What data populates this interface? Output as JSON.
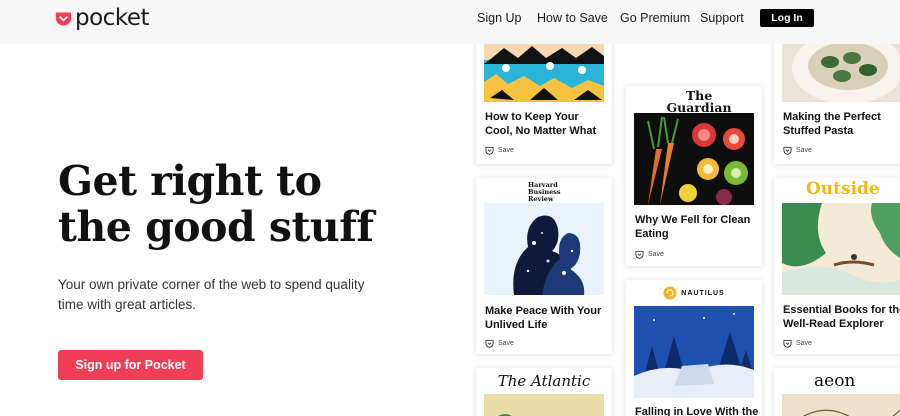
{
  "brand": {
    "name": "pocket",
    "color": "#ef3e56"
  },
  "nav": {
    "items": [
      "Sign Up",
      "How to Save",
      "Go Premium",
      "Support"
    ],
    "login_label": "Log In"
  },
  "hero": {
    "title_line1": "Get right to",
    "title_line2": "the good stuff",
    "subtitle": "Your own private corner of the web to spend quality time with great articles.",
    "cta_label": "Sign up for Pocket"
  },
  "cards": {
    "save_label": "Save",
    "col1": [
      {
        "title": "How to Keep Your Cool, No Matter What"
      },
      {
        "publisher": "Harvard Business Review",
        "title": "Make Peace With Your Unlived Life"
      },
      {
        "publisher": "The Atlantic"
      }
    ],
    "col2": [
      {
        "publisher": "The Guardian",
        "title": "Why We Fell for Clean Eating"
      },
      {
        "publisher": "NAUTILUS",
        "title": "Falling in Love With the"
      }
    ],
    "col3": [
      {
        "title": "Making the Perfect Stuffed Pasta"
      },
      {
        "publisher": "Outside",
        "title": "Essential Books for the Well-Read Explorer"
      },
      {
        "publisher": "aeon"
      }
    ]
  }
}
